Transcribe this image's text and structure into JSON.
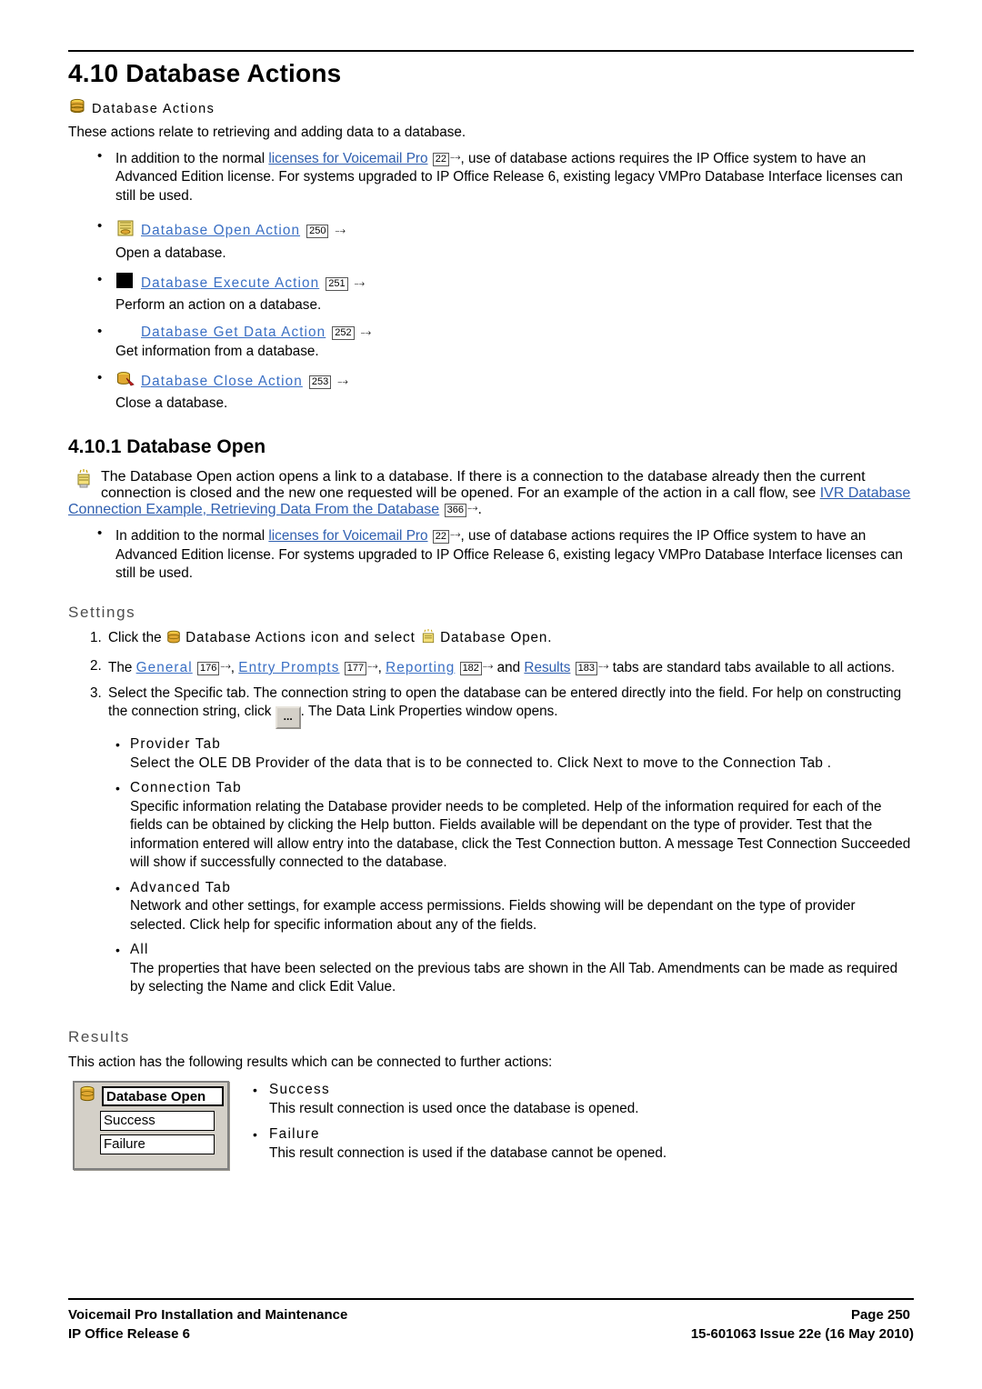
{
  "title": "4.10 Database Actions",
  "caption": "Database Actions",
  "intro": "These actions relate to retrieving and adding data to a database.",
  "license_bullet": {
    "pre": "In addition to the normal ",
    "link": "licenses for Voicemail Pro",
    "pgref": "22",
    "post": ", use of database actions requires the IP Office system to have an Advanced Edition license. For systems upgraded to IP Office Release 6, existing legacy VMPro Database Interface licenses can still be used."
  },
  "action_list": [
    {
      "icon": "database-open-icon",
      "link": "Database Open Action",
      "pgref": "250",
      "desc": "Open a database."
    },
    {
      "icon": "database-execute-icon",
      "link": "Database Execute Action",
      "pgref": "251",
      "desc": "Perform an action on a database."
    },
    {
      "icon": "database-getdata-icon",
      "link": "Database Get Data Action",
      "pgref": "252",
      "desc": "Get information from a database."
    },
    {
      "icon": "database-close-icon",
      "link": "Database Close Action",
      "pgref": "253",
      "desc": "Close a database."
    }
  ],
  "section2": {
    "title": "4.10.1 Database Open",
    "body_pre": "The Database Open action opens a link to a database. If there is a connection to the database already then the current connection is closed and the new one requested will be opened. For an example of the action in a call flow, see ",
    "body_link": "IVR Database Connection Example, Retrieving Data From the Database",
    "body_pgref": "366",
    "body_post": "."
  },
  "settings": {
    "heading": "Settings",
    "step1": {
      "pre": "Click the ",
      "mid": "Database Actions icon and select ",
      "post": "Database Open."
    },
    "step2": {
      "pre": "The ",
      "links": [
        {
          "label": "General",
          "pgref": "176"
        },
        {
          "label": "Entry Prompts",
          "pgref": "177"
        },
        {
          "label": "Reporting",
          "pgref": "182"
        },
        {
          "label": "Results",
          "pgref": "183"
        }
      ],
      "sep1": ", ",
      "sep2": ", ",
      "sep3": " and ",
      "post": " tabs are standard tabs available to all actions."
    },
    "step3": {
      "pre": "Select the Specific tab. The connection string to open the database can be entered directly into the field. For help on constructing the connection string, click ",
      "button": "...",
      "post": ". The Data Link Properties window opens."
    },
    "tabs": [
      {
        "name": "Provider Tab",
        "desc": "Select the OLE DB Provider of the data that is to be connected to. Click Next to move to the Connection Tab ."
      },
      {
        "name": "Connection Tab",
        "desc": "Specific information relating the Database provider needs to be completed. Help of the information required for each of the fields can be obtained by clicking the Help button. Fields available will be dependant on the type of provider. Test that the information entered will allow entry into the database, click the Test Connection button. A message Test Connection Succeeded will show if successfully connected to the database."
      },
      {
        "name": "Advanced Tab",
        "desc": "Network and other settings, for example access permissions. Fields showing will be dependant on the type of provider selected. Click help for specific information about any of the fields."
      },
      {
        "name": "All",
        "desc": "The properties that have been selected on the previous tabs are shown in the All Tab. Amendments can be made as required by selecting the Name and click Edit Value."
      }
    ]
  },
  "results": {
    "heading": "Results",
    "intro": "This action has the following results which can be connected to further actions:",
    "screenshot": {
      "title": "Database Open",
      "items": [
        "Success",
        "Failure"
      ]
    },
    "items": [
      {
        "name": "Success",
        "desc": "This result connection is used once the database is opened."
      },
      {
        "name": "Failure",
        "desc": "This result connection is used if the database cannot be opened."
      }
    ]
  },
  "footer": {
    "left_top": "Voicemail Pro Installation and Maintenance",
    "left_bottom": "IP Office Release 6",
    "right_top": "Page 250",
    "right_bottom": "15-601063 Issue 22e (16 May 2010)"
  },
  "colors": {
    "link": "#2f5fb0",
    "link_bold": "#3a6fc4",
    "heading_gray": "#4d4d4d"
  }
}
